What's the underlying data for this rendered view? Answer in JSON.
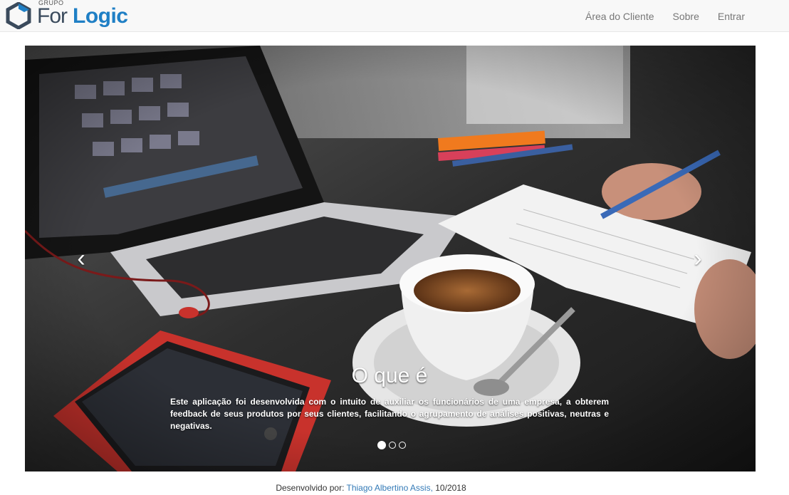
{
  "brand": {
    "small": "GRUPO",
    "name_part1": "For",
    "name_part2": "Logic"
  },
  "nav": {
    "items": [
      {
        "label": "Área do Cliente"
      },
      {
        "label": "Sobre"
      },
      {
        "label": "Entrar"
      }
    ]
  },
  "carousel": {
    "prev_icon": "chevron-left",
    "next_icon": "chevron-right",
    "slide": {
      "title": "O que é",
      "text": "Este aplicação foi desenvolvida com o intuito de auxiliar os funcionários de uma empresa, a obterem feedback de seus produtos por seus clientes, facilitando o agrupamento de análises positivas, neutras e negativas."
    },
    "indicator_count": 3,
    "active_indicator": 1
  },
  "footer": {
    "prefix": "Desenvolvido por: ",
    "author": "Thiago Albertino Assis,",
    "date": " 10/2018"
  },
  "colors": {
    "brand_blue": "#1f7fc5",
    "link": "#337ab7",
    "navbar_bg": "#f8f8f8"
  }
}
